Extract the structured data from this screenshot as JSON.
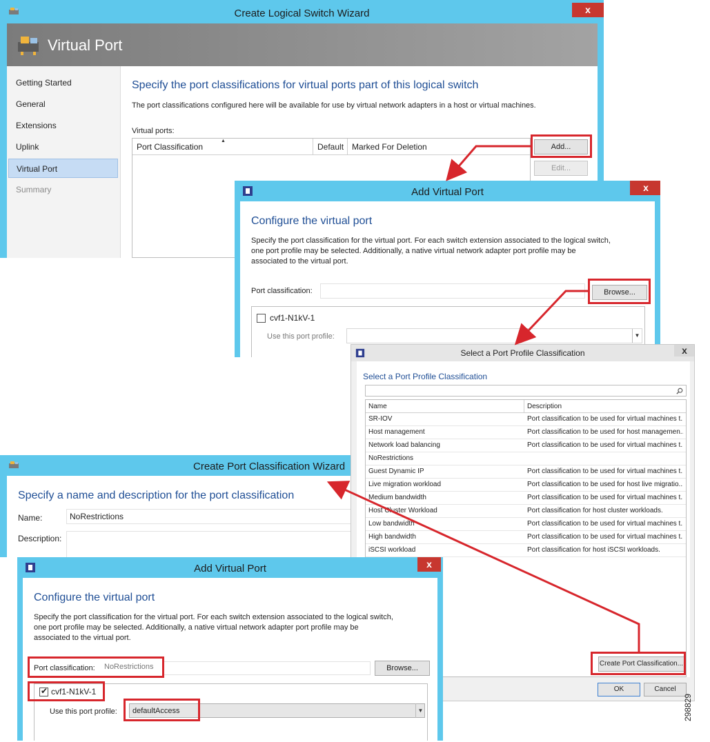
{
  "wizard": {
    "title": "Create Logical Switch Wizard",
    "banner_title": "Virtual Port",
    "nav": [
      "Getting Started",
      "General",
      "Extensions",
      "Uplink",
      "Virtual Port",
      "Summary"
    ],
    "heading": "Specify the port classifications for virtual ports part of this logical switch",
    "subtext": "The port classifications configured here will be available for use by virtual network adapters in a host or virtual machines.",
    "virtual_ports_label": "Virtual ports:",
    "columns": [
      "Port Classification",
      "Default",
      "Marked For Deletion"
    ],
    "add_label": "Add...",
    "edit_label": "Edit..."
  },
  "add_vp_top": {
    "title": "Add Virtual Port",
    "heading": "Configure the virtual port",
    "desc_lines": [
      "Specify the port classification for the virtual port. For each switch extension associated to the logical switch,",
      "one port profile may be selected. Additionally, a native virtual network adapter port profile may be",
      "associated to the virtual port."
    ],
    "port_class_label": "Port classification:",
    "browse_label": "Browse...",
    "extension_name": "cvf1-N1kV-1",
    "use_profile_label": "Use this port profile:"
  },
  "select_ppc": {
    "title": "Select a Port Profile Classification",
    "heading": "Select a Port Profile Classification",
    "columns": [
      "Name",
      "Description"
    ],
    "rows": [
      {
        "name": "SR-IOV",
        "desc": "Port classification to be used for virtual machines t..."
      },
      {
        "name": "Host management",
        "desc": "Port classification to be used for host managemen..."
      },
      {
        "name": "Network load balancing",
        "desc": "Port classification to be used for virtual machines t..."
      },
      {
        "name": "NoRestrictions",
        "desc": ""
      },
      {
        "name": "Guest Dynamic IP",
        "desc": "Port classification to be used for virtual machines t..."
      },
      {
        "name": "Live migration  workload",
        "desc": "Port classification to be used for host live migratio..."
      },
      {
        "name": "Medium bandwidth",
        "desc": "Port classification to be used for virtual machines t..."
      },
      {
        "name": "Host Cluster Workload",
        "desc": "Port classification for host cluster workloads."
      },
      {
        "name": "Low bandwidth",
        "desc": "Port classification to be used for virtual machines t..."
      },
      {
        "name": "High bandwidth",
        "desc": "Port classification to be used for virtual machines t..."
      },
      {
        "name": "iSCSI workload",
        "desc": "Port classification for host iSCSI workloads."
      }
    ],
    "create_label": "Create Port Classification...",
    "ok_label": "OK",
    "cancel_label": "Cancel"
  },
  "create_pc": {
    "title": "Create Port Classification Wizard",
    "heading": "Specify a name and description for the port classification",
    "name_label": "Name:",
    "name_value": "NoRestrictions",
    "desc_label": "Description:"
  },
  "add_vp_bottom": {
    "title": "Add Virtual Port",
    "heading": "Configure the virtual port",
    "desc_lines": [
      "Specify the port classification for the virtual port. For each switch extension associated to the logical switch,",
      "one port profile may be selected. Additionally, a native virtual network adapter port profile may be",
      "associated to the virtual port."
    ],
    "port_class_label": "Port classification:",
    "port_class_value": "NoRestrictions",
    "browse_label": "Browse...",
    "extension_name": "cvf1-N1kV-1",
    "use_profile_label": "Use this port profile:",
    "profile_value": "defaultAccess"
  },
  "figure_id": "298829",
  "colors": {
    "titlebar": "#5ec8ec",
    "highlight": "#d7262c",
    "heading": "#1f4e95"
  },
  "icons": {
    "app": "switch-icon",
    "close": "close-icon",
    "search": "search-icon",
    "dropdown": "chevron-down-icon"
  }
}
